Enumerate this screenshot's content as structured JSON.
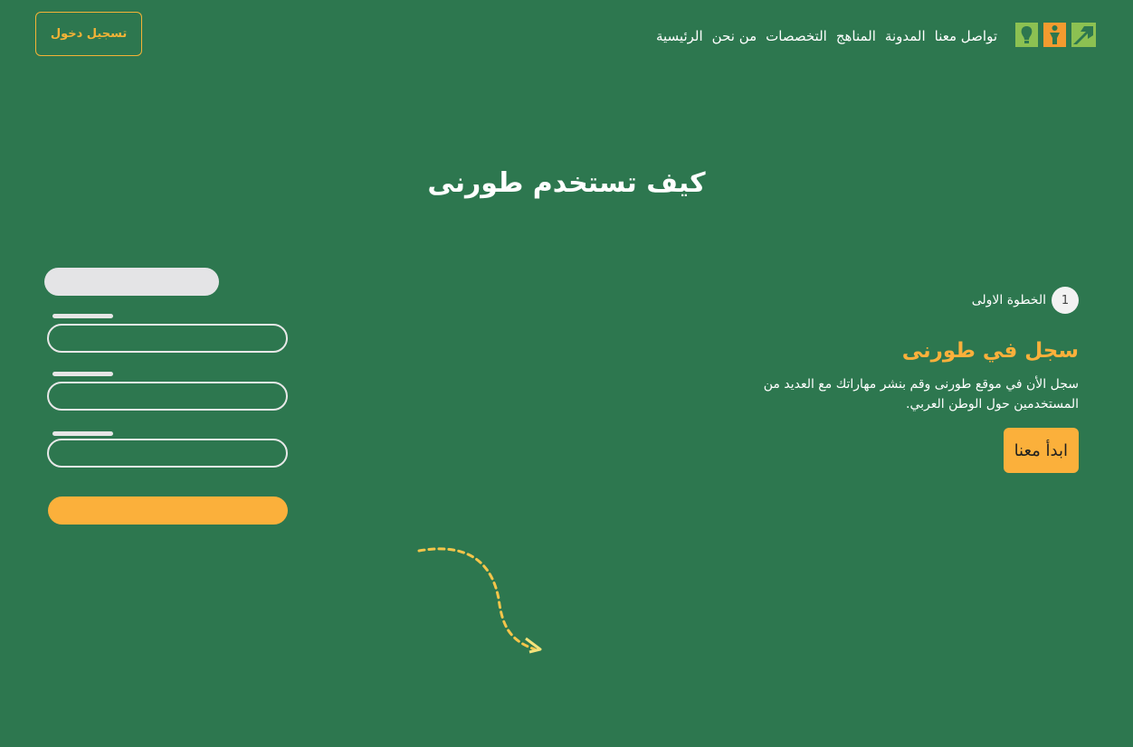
{
  "header": {
    "logo_name": "site-logo",
    "nav": [
      {
        "label": "الرئيسية"
      },
      {
        "label": "من نحن"
      },
      {
        "label": "التخصصات"
      },
      {
        "label": "المناهج"
      },
      {
        "label": "المدونة"
      },
      {
        "label": "تواصل معنا"
      }
    ],
    "login_label": "تسجيل دخول"
  },
  "section": {
    "title": "كيف تستخدم طورنى"
  },
  "step": {
    "number": "1",
    "label": "الخطوة الاولى",
    "heading": "سجل في طورنى",
    "description": "سجل الأن في موقع طورنى وقم بنشر مهاراتك مع العديد من المستخدمين حول الوطن العربي.",
    "button_label": "ابدأ معنا"
  },
  "colors": {
    "background": "#2d774f",
    "accent": "#fbb03b",
    "logo_green": "#8cc152",
    "logo_orange": "#f39b2f"
  }
}
